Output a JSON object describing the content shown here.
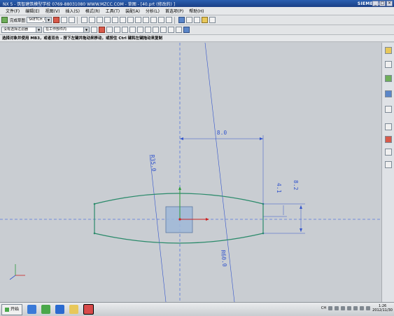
{
  "window": {
    "title": "NX 5 - 筑智建筑模型学校  0769-88031080  WWW.MZCC.COM - 草图 - [40.prt (修改的) ]",
    "brand": "SIEMENS",
    "win_min": "_",
    "win_max": "□",
    "win_close": "×"
  },
  "menubar": [
    "文件(F)",
    "编辑(E)",
    "视图(V)",
    "插入(S)",
    "格式(R)",
    "工具(T)",
    "装配(A)",
    "分析(L)",
    "首选项(P)",
    "帮助(H)"
  ],
  "toolbar": {
    "finish_sketch": "完成草图",
    "sketch_name": "SKETCH_000",
    "filter_label": "没有选择过滤器",
    "scope_label": "在工作部件内"
  },
  "status": "选择对象并使用 MB3，或者双击 - 按下左键并拖动来移动，或按住 Ctrl 键和左键拖动来复制",
  "dimensions": {
    "d1": "8.0",
    "d2": "R35.0",
    "d3": "R60.0",
    "d4": "4.1",
    "d5": "8.2"
  },
  "taskbar": {
    "start": "开始",
    "lang": "CH",
    "time": "1:26",
    "date": "2012/11/30"
  },
  "colors": {
    "sketch_curve": "#2a8a6a",
    "dimension": "#3355cc",
    "axis": "#5577dd"
  }
}
